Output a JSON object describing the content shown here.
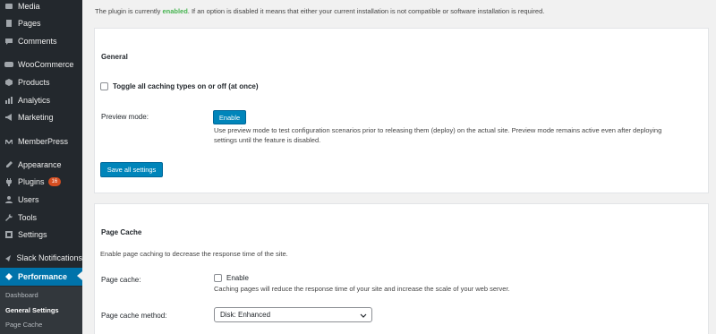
{
  "sidebar": {
    "items": [
      {
        "label": "Media",
        "icon": "media-icon"
      },
      {
        "label": "Pages",
        "icon": "pages-icon"
      },
      {
        "label": "Comments",
        "icon": "comments-icon"
      },
      {
        "label": "WooCommerce",
        "icon": "woocommerce-icon"
      },
      {
        "label": "Products",
        "icon": "products-icon"
      },
      {
        "label": "Analytics",
        "icon": "analytics-icon"
      },
      {
        "label": "Marketing",
        "icon": "marketing-icon"
      },
      {
        "label": "MemberPress",
        "icon": "memberpress-icon"
      },
      {
        "label": "Appearance",
        "icon": "appearance-icon"
      },
      {
        "label": "Plugins",
        "icon": "plugins-icon",
        "badge": "16"
      },
      {
        "label": "Users",
        "icon": "users-icon"
      },
      {
        "label": "Tools",
        "icon": "tools-icon"
      },
      {
        "label": "Settings",
        "icon": "settings-icon"
      },
      {
        "label": "Slack Notifications",
        "icon": "slack-icon"
      },
      {
        "label": "Performance",
        "icon": "performance-icon"
      }
    ],
    "submenu": [
      "Dashboard",
      "General Settings",
      "Page Cache"
    ],
    "colors": {
      "background": "#23282d",
      "active": "#0073aa",
      "submenu": "#32373c"
    }
  },
  "notice": {
    "prefix": "The plugin is currently ",
    "status": "enabled",
    "suffix": ". If an option is disabled it means that either your current installation is not compatible or software installation is required."
  },
  "general": {
    "title": "General",
    "toggle_label": "Toggle all caching types on or off (at once)",
    "preview_label": "Preview mode:",
    "enable_button": "Enable",
    "preview_desc_1": "Use preview mode to test configuration scenarios prior to releasing them (deploy) on the actual site. Preview mode remains active even after deploying",
    "preview_desc_2": "settings until the feature is disabled.",
    "save_button": "Save all settings"
  },
  "page_cache": {
    "title": "Page Cache",
    "intro": "Enable page caching to decrease the response time of the site.",
    "cache_label": "Page cache:",
    "enable_label": "Enable",
    "cache_desc": "Caching pages will reduce the response time of your site and increase the scale of your web server.",
    "method_label": "Page cache method:",
    "method_value": "Disk: Enhanced"
  },
  "colors": {
    "accent": "#0085ba",
    "enabled": "#46b450"
  }
}
